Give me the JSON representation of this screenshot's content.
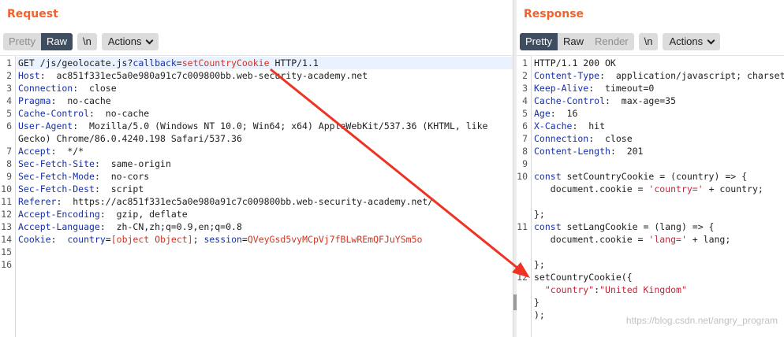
{
  "request": {
    "title": "Request",
    "tabs": [
      "Pretty",
      "Raw"
    ],
    "active_tab": "Raw",
    "newline_label": "\\n",
    "actions_label": "Actions",
    "lines": [
      {
        "n": "1",
        "segments": [
          [
            "v",
            "GET /js/geolocate.js?"
          ],
          [
            "h",
            "callback"
          ],
          [
            "v",
            "="
          ],
          [
            "red",
            "setCountryCookie"
          ],
          [
            "v",
            " HTTP/1.1"
          ]
        ]
      },
      {
        "n": "2",
        "segments": [
          [
            "h",
            "Host"
          ],
          [
            "v",
            ":  ac851f331ec5a0e980a91c7c009800bb.web-security-academy.net"
          ]
        ]
      },
      {
        "n": "3",
        "segments": [
          [
            "h",
            "Connection"
          ],
          [
            "v",
            ":  close"
          ]
        ]
      },
      {
        "n": "4",
        "segments": [
          [
            "h",
            "Pragma"
          ],
          [
            "v",
            ":  no-cache"
          ]
        ]
      },
      {
        "n": "5",
        "segments": [
          [
            "h",
            "Cache-Control"
          ],
          [
            "v",
            ":  no-cache"
          ]
        ]
      },
      {
        "n": "6",
        "segments": [
          [
            "h",
            "User-Agent"
          ],
          [
            "v",
            ":  Mozilla/5.0 (Windows NT 10.0; Win64; x64) AppleWebKit/537.36 (KHTML, like"
          ]
        ]
      },
      {
        "n": "",
        "segments": [
          [
            "v",
            "Gecko) Chrome/86.0.4240.198 Safari/537.36"
          ]
        ]
      },
      {
        "n": "7",
        "segments": [
          [
            "h",
            "Accept"
          ],
          [
            "v",
            ":  */*"
          ]
        ]
      },
      {
        "n": "8",
        "segments": [
          [
            "h",
            "Sec-Fetch-Site"
          ],
          [
            "v",
            ":  same-origin"
          ]
        ]
      },
      {
        "n": "9",
        "segments": [
          [
            "h",
            "Sec-Fetch-Mode"
          ],
          [
            "v",
            ":  no-cors"
          ]
        ]
      },
      {
        "n": "10",
        "segments": [
          [
            "h",
            "Sec-Fetch-Dest"
          ],
          [
            "v",
            ":  script"
          ]
        ]
      },
      {
        "n": "11",
        "segments": [
          [
            "h",
            "Referer"
          ],
          [
            "v",
            ":  https://ac851f331ec5a0e980a91c7c009800bb.web-security-academy.net/"
          ]
        ]
      },
      {
        "n": "12",
        "segments": [
          [
            "h",
            "Accept-Encoding"
          ],
          [
            "v",
            ":  gzip, deflate"
          ]
        ]
      },
      {
        "n": "13",
        "segments": [
          [
            "h",
            "Accept-Language"
          ],
          [
            "v",
            ":  zh-CN,zh;q=0.9,en;q=0.8"
          ]
        ]
      },
      {
        "n": "14",
        "segments": [
          [
            "h",
            "Cookie"
          ],
          [
            "v",
            ":  "
          ],
          [
            "h",
            "country"
          ],
          [
            "v",
            "="
          ],
          [
            "red",
            "[object Object]"
          ],
          [
            "v",
            "; "
          ],
          [
            "h",
            "session"
          ],
          [
            "v",
            "="
          ],
          [
            "red",
            "QVeyGsd5vyMCpVj7fBLwREmQFJuYSm5o"
          ]
        ]
      },
      {
        "n": "15",
        "segments": []
      },
      {
        "n": "16",
        "segments": []
      }
    ]
  },
  "response": {
    "title": "Response",
    "tabs": [
      "Pretty",
      "Raw",
      "Render"
    ],
    "active_tab": "Pretty",
    "newline_label": "\\n",
    "actions_label": "Actions",
    "lines": [
      {
        "n": "1",
        "segments": [
          [
            "v",
            "HTTP/1.1 200 OK"
          ]
        ]
      },
      {
        "n": "2",
        "segments": [
          [
            "h",
            "Content-Type"
          ],
          [
            "v",
            ":  application/javascript; charset=utf-8"
          ]
        ]
      },
      {
        "n": "3",
        "segments": [
          [
            "h",
            "Keep-Alive"
          ],
          [
            "v",
            ":  timeout=0"
          ]
        ]
      },
      {
        "n": "4",
        "segments": [
          [
            "h",
            "Cache-Control"
          ],
          [
            "v",
            ":  max-age=35"
          ]
        ]
      },
      {
        "n": "5",
        "segments": [
          [
            "h",
            "Age"
          ],
          [
            "v",
            ":  16"
          ]
        ]
      },
      {
        "n": "6",
        "segments": [
          [
            "h",
            "X-Cache"
          ],
          [
            "v",
            ":  hit"
          ]
        ]
      },
      {
        "n": "7",
        "segments": [
          [
            "h",
            "Connection"
          ],
          [
            "v",
            ":  close"
          ]
        ]
      },
      {
        "n": "8",
        "segments": [
          [
            "h",
            "Content-Length"
          ],
          [
            "v",
            ":  201"
          ]
        ]
      },
      {
        "n": "9",
        "segments": []
      },
      {
        "n": "10",
        "segments": [
          [
            "p",
            "const"
          ],
          [
            "v",
            " setCountryCookie = (country) => {"
          ]
        ]
      },
      {
        "n": "",
        "segments": [
          [
            "v",
            "   document.cookie = "
          ],
          [
            "str",
            "'country='"
          ],
          [
            "v",
            " + country;"
          ]
        ]
      },
      {
        "n": "",
        "segments": []
      },
      {
        "n": "",
        "segments": [
          [
            "v",
            "};"
          ]
        ]
      },
      {
        "n": "11",
        "segments": [
          [
            "p",
            "const"
          ],
          [
            "v",
            " setLangCookie = (lang) => {"
          ]
        ]
      },
      {
        "n": "",
        "segments": [
          [
            "v",
            "   document.cookie = "
          ],
          [
            "str",
            "'lang='"
          ],
          [
            "v",
            " + lang;"
          ]
        ]
      },
      {
        "n": "",
        "segments": []
      },
      {
        "n": "",
        "segments": [
          [
            "v",
            "};"
          ]
        ]
      },
      {
        "n": "12",
        "segments": [
          [
            "v",
            "setCountryCookie({"
          ]
        ]
      },
      {
        "n": "",
        "segments": [
          [
            "str",
            "  \"country\""
          ],
          [
            "v",
            ":"
          ],
          [
            "str",
            "\"United Kingdom\""
          ]
        ]
      },
      {
        "n": "",
        "segments": [
          [
            "v",
            "}"
          ]
        ]
      },
      {
        "n": "",
        "segments": [
          [
            "v",
            ");"
          ]
        ]
      }
    ]
  },
  "watermark": "https://blog.csdn.net/angry_program",
  "colors": {
    "accent_title": "#f0622c",
    "active_tab_bg": "#3e4d60",
    "header_name": "#1530a8",
    "highlight_value": "#d4321e",
    "arrow": "#ee3324"
  }
}
